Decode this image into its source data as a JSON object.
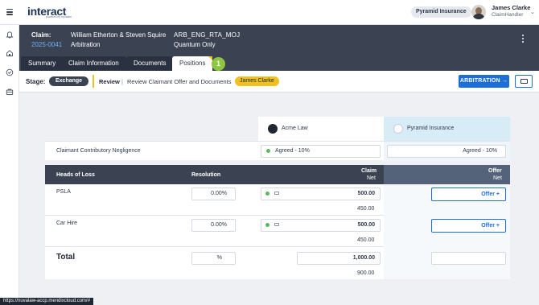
{
  "app": {
    "logo": "interact",
    "logo_sub": "powered by nuvalaw",
    "insurer": "Pyramid Insurance"
  },
  "user": {
    "name": "James Clarke",
    "role": "ClaimHandler"
  },
  "claim": {
    "label": "Claim:",
    "id": "2025-0041",
    "names": "William Etherton & Steven Squire",
    "type": "Arbitration",
    "ref": "ARB_ENG_RTA_MOJ",
    "scope": "Quantum Only"
  },
  "tabs": [
    {
      "label": "Summary"
    },
    {
      "label": "Claim Information"
    },
    {
      "label": "Documents"
    },
    {
      "label": "Positions"
    }
  ],
  "tab_badge": "1",
  "stage": {
    "label": "Stage:",
    "value": "Exchange",
    "step": "Review",
    "separator": "|",
    "task": "Review Claimant Offer and Documents",
    "assignee": "James Clarke",
    "action_button": "ARBITRATION →"
  },
  "parties": {
    "left": "Acme Law",
    "right": "Pyramid Insurance"
  },
  "negligence": {
    "label": "Claimant Contributory Negligence",
    "left_value": "Agreed - 10%",
    "right_value": "Agreed - 10%"
  },
  "table": {
    "headers": {
      "heads": "Heads of Loss",
      "resolution": "Resolution",
      "claim": "Claim",
      "claim_sub": "Net",
      "offer": "Offer",
      "offer_sub": "Net"
    },
    "rows": [
      {
        "head": "PSLA",
        "resolution": "0.00%",
        "claim": "500.00",
        "net": "450.00",
        "offer_button": "Offer +"
      },
      {
        "head": "Car Hire",
        "resolution": "0.00%",
        "claim": "500.00",
        "net": "450.00",
        "offer_button": "Offer +"
      }
    ],
    "total": {
      "label": "Total",
      "resolution": "%",
      "claim": "1,000.00",
      "net": "900.00"
    }
  },
  "status_url": "https://nuvalaw-accp.mendixcloud.com/#",
  "colors": {
    "accent": "#1d6fd6",
    "header_bg": "#3b4353",
    "highlight": "#f0c020",
    "badge": "#8dc63f",
    "agreed": "#5cb85c"
  }
}
